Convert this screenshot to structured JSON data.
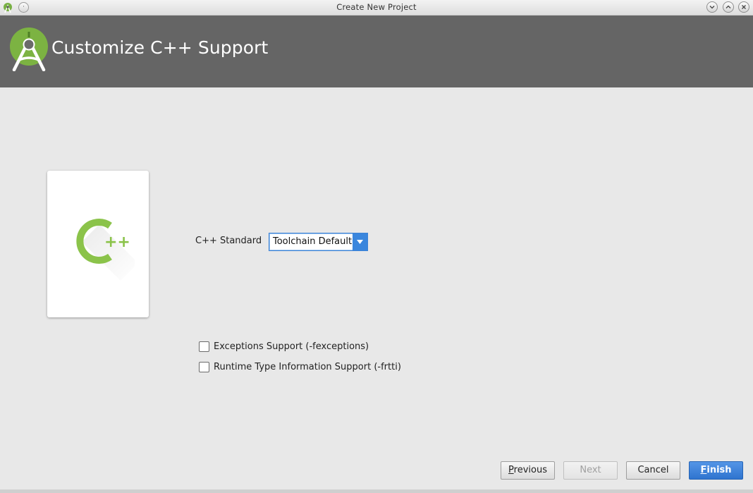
{
  "window": {
    "title": "Create New Project",
    "icons": [
      "android-studio-icon",
      "window-menu-icon",
      "minimize-icon",
      "maximize-icon",
      "close-icon"
    ]
  },
  "header": {
    "title": "Customize C++ Support",
    "logo": "android-studio-logo"
  },
  "main": {
    "illustration": "cpp-logo",
    "cpp_standard": {
      "label": "C++ Standard",
      "selected": "Toolchain Default"
    },
    "options": [
      {
        "label": "Exceptions Support (-fexceptions)",
        "checked": false
      },
      {
        "label": "Runtime Type Information Support (-frtti)",
        "checked": false
      }
    ]
  },
  "footer": {
    "previous": {
      "mnemonic": "P",
      "rest": "revious",
      "enabled": true
    },
    "next": {
      "label": "Next",
      "enabled": false
    },
    "cancel": {
      "label": "Cancel",
      "enabled": true
    },
    "finish": {
      "mnemonic": "F",
      "rest": "inish",
      "enabled": true
    }
  },
  "colors": {
    "header_bg": "#656565",
    "accent_blue": "#3a86dd",
    "android_green": "#8bc34a"
  }
}
